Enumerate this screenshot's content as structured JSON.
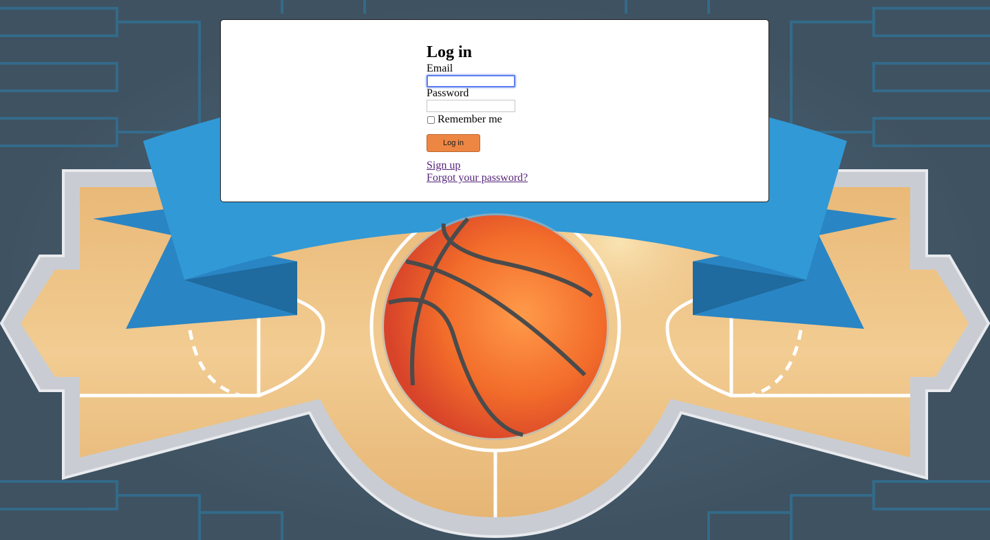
{
  "login": {
    "title": "Log in",
    "email_label": "Email",
    "email_value": "",
    "password_label": "Password",
    "password_value": "",
    "remember_label": "Remember me",
    "remember_checked": false,
    "submit_label": "Log in",
    "signup_link": "Sign up",
    "forgot_link": "Forgot your password?"
  },
  "colors": {
    "background": "#3f5261",
    "button": "#ee8643",
    "link": "#55237a",
    "ribbon": "#2d8fcf",
    "ball": "#f26c2a"
  },
  "background_art": {
    "description_icon": "basketball-court-icon"
  }
}
